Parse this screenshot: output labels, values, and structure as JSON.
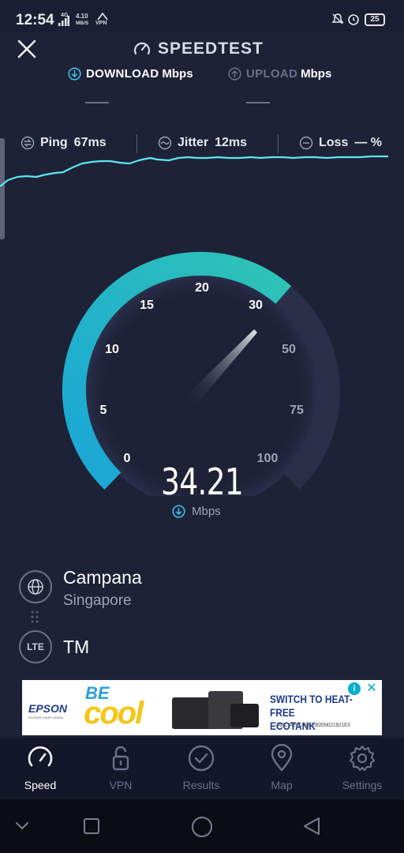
{
  "status_bar": {
    "time": "12:54",
    "network_type": "4G",
    "speed_value": "4.10",
    "speed_unit": "MB/S",
    "vpn": "VPN",
    "battery": "25"
  },
  "header": {
    "title": "SPEEDTEST",
    "download_label": "DOWNLOAD",
    "download_unit": "Mbps",
    "upload_label": "UPLOAD",
    "upload_unit": "Mbps",
    "download_value": "—",
    "upload_value": "—"
  },
  "metrics": {
    "ping_label": "Ping",
    "ping_value": "67ms",
    "jitter_label": "Jitter",
    "jitter_value": "12ms",
    "loss_label": "Loss",
    "loss_value": "— %"
  },
  "gauge": {
    "ticks": [
      "0",
      "5",
      "10",
      "15",
      "20",
      "30",
      "50",
      "75",
      "100"
    ],
    "current_speed": "34.21",
    "unit": "Mbps",
    "accent_start": "#1aa6d6",
    "accent_end": "#2ec4b6",
    "track_color": "#2a3049"
  },
  "server": {
    "name": "Campana",
    "location": "Singapore",
    "isp": "TM",
    "isp_badge": "LTE"
  },
  "ad": {
    "brand": "EPSON",
    "brand_tagline": "EXCEED YOUR VISION",
    "be": "BE",
    "cool": "cool",
    "headline_line1": "SWITCH TO HEAT-FREE",
    "headline_line2": "ECOTANK PRINTERS",
    "ref_code": "ABC Ref Code EB05N021821E3",
    "info_icon": "i",
    "close_icon": "✕"
  },
  "bottom_nav": {
    "items": [
      {
        "label": "Speed",
        "icon": "speedometer-icon",
        "active": true
      },
      {
        "label": "VPN",
        "icon": "unlocked-padlock-icon",
        "active": false
      },
      {
        "label": "Results",
        "icon": "check-circle-icon",
        "active": false
      },
      {
        "label": "Map",
        "icon": "map-pin-icon",
        "active": false
      },
      {
        "label": "Settings",
        "icon": "gear-icon",
        "active": false
      }
    ]
  }
}
